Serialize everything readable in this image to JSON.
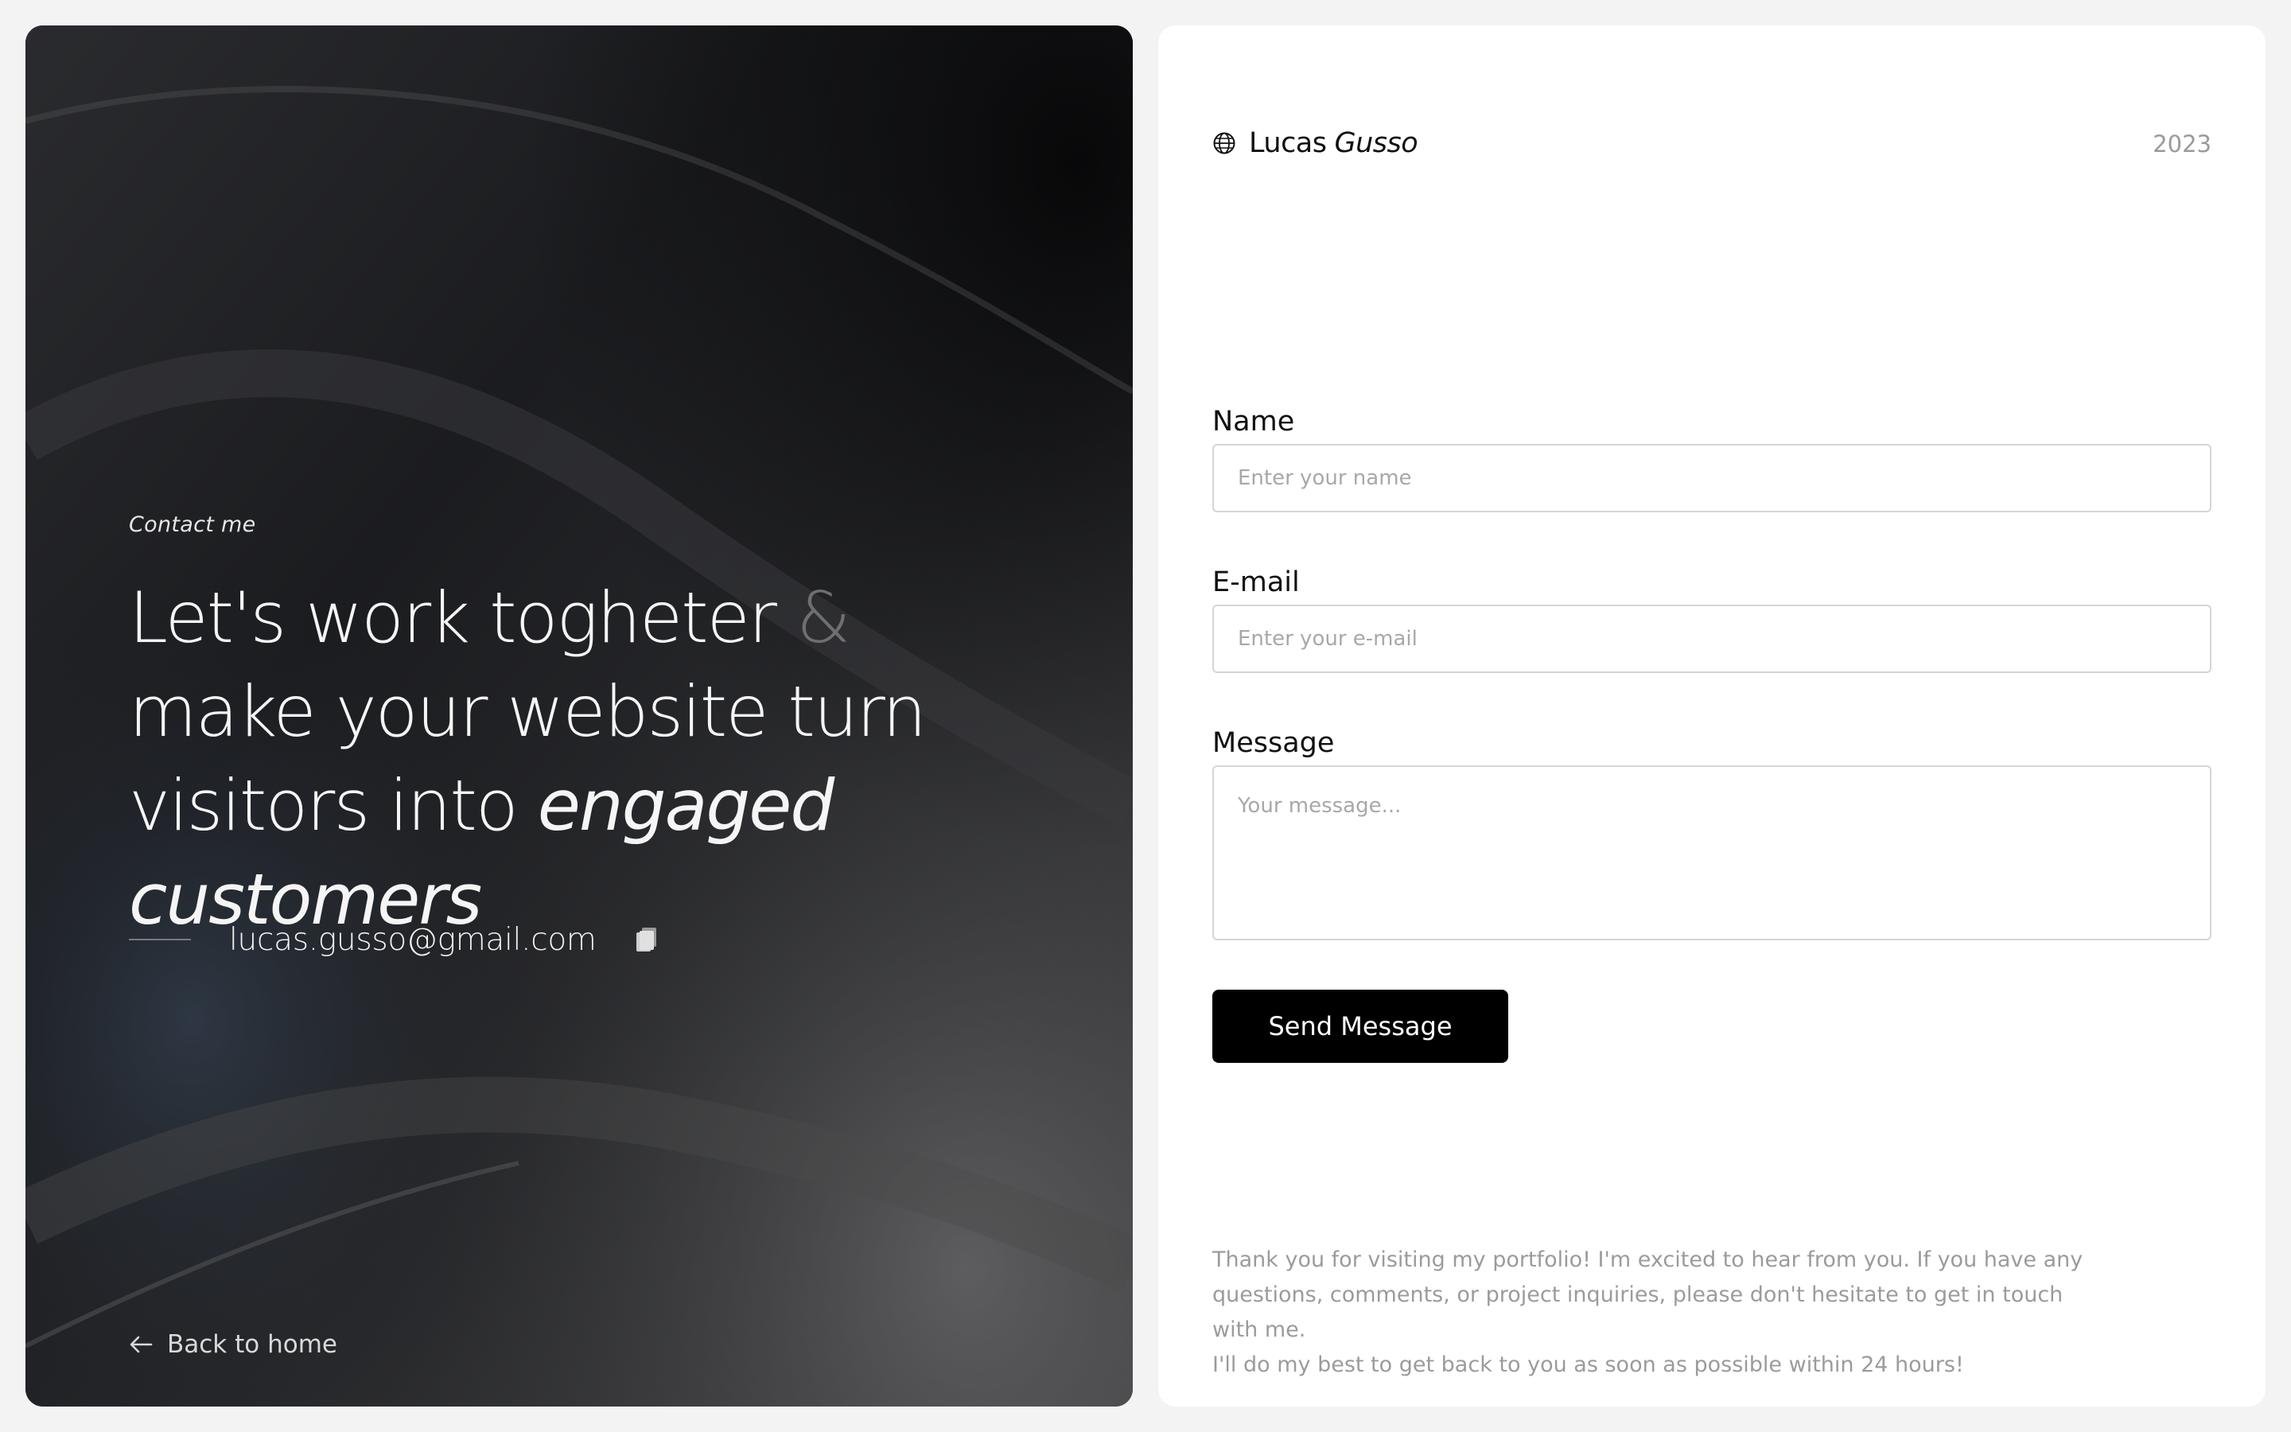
{
  "left": {
    "eyebrow": "Contact me",
    "headline": {
      "part1": "Let's work togheter",
      "amp": "&",
      "part2": "make your website turn visitors into",
      "emphasis": "engaged customers"
    },
    "email": "lucas.gusso@gmail.com",
    "back_label": "Back to home",
    "icons": {
      "copy": "copy-icon",
      "back": "arrow-left-icon"
    }
  },
  "right": {
    "brand": {
      "first": "Lucas",
      "last": "Gusso",
      "logo_icon": "globe-icon"
    },
    "year": "2023",
    "form": {
      "name_label": "Name",
      "name_placeholder": "Enter your name",
      "email_label": "E-mail",
      "email_placeholder": "Enter your e-mail",
      "message_label": "Message",
      "message_placeholder": "Your message...",
      "submit_label": "Send Message"
    },
    "footer": {
      "line1": "Thank you for visiting my portfolio! I'm excited to hear from you. If you have any",
      "line2": "questions, comments, or project inquiries, please don't hesitate to get in touch with me.",
      "line3": "I'll do my best to get back to you as soon as possible within 24 hours!"
    }
  },
  "colors": {
    "page_bg": "#f3f3f3",
    "dark_panel": "#151618",
    "button_bg": "#000000",
    "muted_text": "#9b9b9b"
  }
}
